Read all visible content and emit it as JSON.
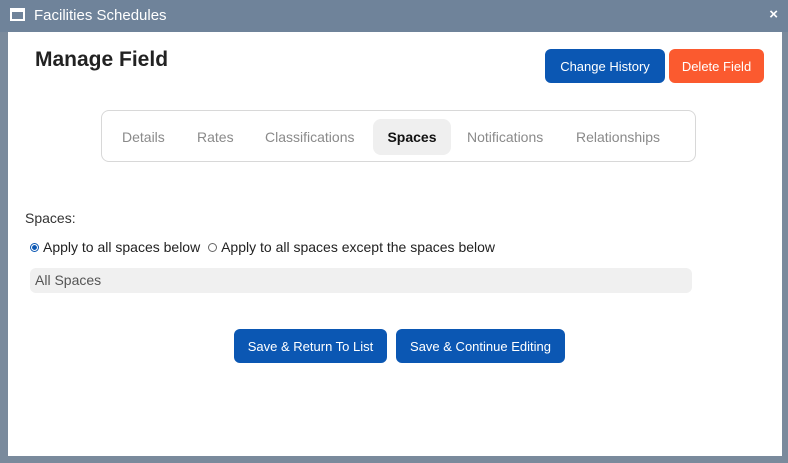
{
  "window": {
    "title": "Facilities Schedules",
    "close_symbol": "×",
    "icon": "window-icon"
  },
  "header": {
    "page_title": "Manage Field",
    "change_history_label": "Change History",
    "delete_field_label": "Delete Field"
  },
  "tabs": {
    "items": [
      {
        "label": "Details"
      },
      {
        "label": "Rates"
      },
      {
        "label": "Classifications"
      },
      {
        "label": "Spaces"
      },
      {
        "label": "Notifications"
      },
      {
        "label": "Relationships"
      }
    ],
    "active": "Spaces"
  },
  "spaces": {
    "label": "Spaces:",
    "option_all": "Apply to all spaces below",
    "option_except": "Apply to all spaces except the spaces below",
    "selected_option": "Apply to all spaces below",
    "list_value": "All Spaces"
  },
  "actions": {
    "save_return_label": "Save & Return To List",
    "save_continue_label": "Save & Continue Editing"
  },
  "colors": {
    "primary": "#0b57b3",
    "danger": "#fb5a2f",
    "titlebar": "#6f839a"
  }
}
